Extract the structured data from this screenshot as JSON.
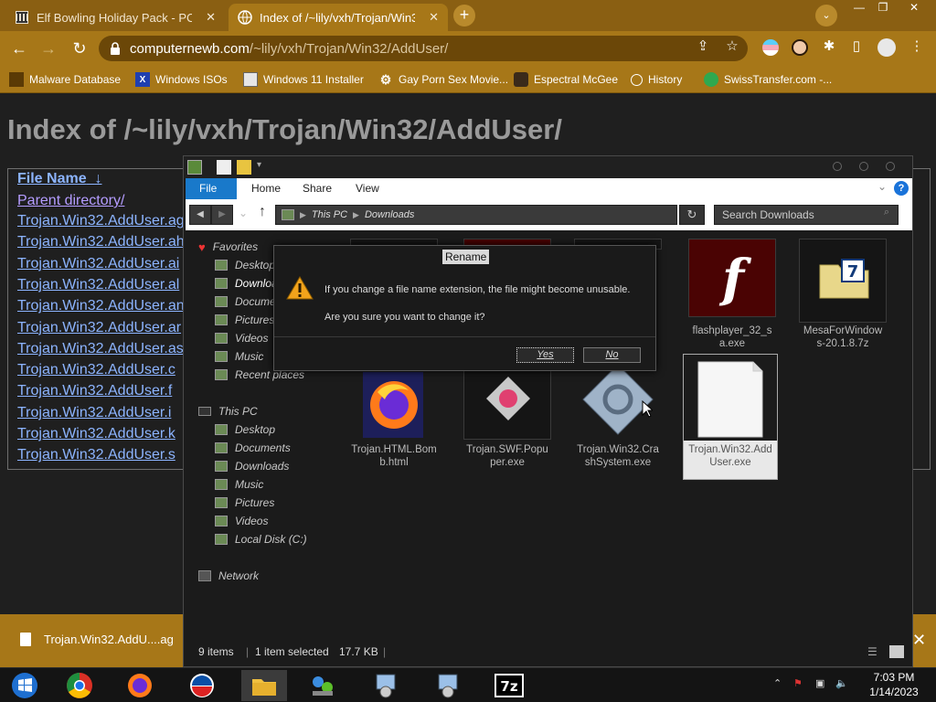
{
  "browser": {
    "tabs": [
      {
        "title": "Elf Bowling Holiday Pack - PC gam",
        "icon": "museum-icon",
        "active": false
      },
      {
        "title": "Index of /~lily/vxh/Trojan/Win3",
        "icon": "globe-icon",
        "active": true
      }
    ],
    "new_tab": "+",
    "tab_search": "⌄",
    "window": {
      "minimize": "—",
      "restore": "❐",
      "close": "✕"
    },
    "url_host": "computernewb.com",
    "url_path": "/~lily/vxh/Trojan/Win32/AddUser/",
    "bookmarks": [
      "Malware Database",
      "Windows ISOs",
      "Windows 11 Installer",
      "Gay Porn Sex Movie...",
      "Espectral McGee",
      "History",
      "SwissTransfer.com -..."
    ]
  },
  "page": {
    "title": "Index of /~lily/vxh/Trojan/Win32/AddUser/",
    "column_header": "File Name",
    "sort_arrow": "↓",
    "parent_link": "Parent directory/",
    "files": [
      "Trojan.Win32.AddUser.ag",
      "Trojan.Win32.AddUser.ah",
      "Trojan.Win32.AddUser.ai",
      "Trojan.Win32.AddUser.al",
      "Trojan.Win32.AddUser.an",
      "Trojan.Win32.AddUser.ar",
      "Trojan.Win32.AddUser.as",
      "Trojan.Win32.AddUser.c",
      "Trojan.Win32.AddUser.f",
      "Trojan.Win32.AddUser.i",
      "Trojan.Win32.AddUser.k",
      "Trojan.Win32.AddUser.s"
    ]
  },
  "download_shelf": {
    "filename": "Trojan.Win32.AddU....ag",
    "close": "✕"
  },
  "explorer": {
    "ribbon_tabs": [
      "File",
      "Home",
      "Share",
      "View"
    ],
    "breadcrumb": [
      "This PC",
      "Downloads"
    ],
    "search_placeholder": "Search Downloads",
    "nav": {
      "favorites": "Favorites",
      "favorites_items": [
        "Desktop",
        "Downloads",
        "Documents",
        "Pictures",
        "Videos",
        "Music",
        "Recent places"
      ],
      "this_pc": "This PC",
      "this_pc_items": [
        "Desktop",
        "Documents",
        "Downloads",
        "Music",
        "Pictures",
        "Videos",
        "Local Disk (C:)"
      ],
      "network": "Network"
    },
    "files": [
      {
        "name": "flashplayer_32_s\na.exe",
        "icon": "flash-icon"
      },
      {
        "name": "MesaForWindow\ns-20.1.8.7z",
        "icon": "archive-icon"
      },
      {
        "name": "Trojan.HTML.Bom\nb.html",
        "icon": "firefox-file-icon"
      },
      {
        "name": "Trojan.SWF.Popu\nper.exe",
        "icon": "swf-icon"
      },
      {
        "name": "Trojan.Win32.Cra\nshSystem.exe",
        "icon": "gear-file-icon"
      },
      {
        "name": "Trojan.Win32.Add\nUser.exe",
        "icon": "blank-file-icon"
      }
    ],
    "status": {
      "items": "9 items",
      "selected": "1 item selected",
      "size": "17.7 KB"
    }
  },
  "dialog": {
    "title": "Rename",
    "message": "If you change a file name extension, the file might become unusable.",
    "question": "Are you sure you want to change it?",
    "yes": "Yes",
    "no": "No"
  },
  "taskbar": {
    "time": "7:03 PM",
    "date": "1/14/2023",
    "apps": [
      "windows-start-icon",
      "chrome-icon",
      "firefox-icon",
      "edge-logo-icon",
      "file-explorer-icon",
      "network-share-icon",
      "installer-icon",
      "installer-icon-2",
      "7zip-icon"
    ]
  }
}
